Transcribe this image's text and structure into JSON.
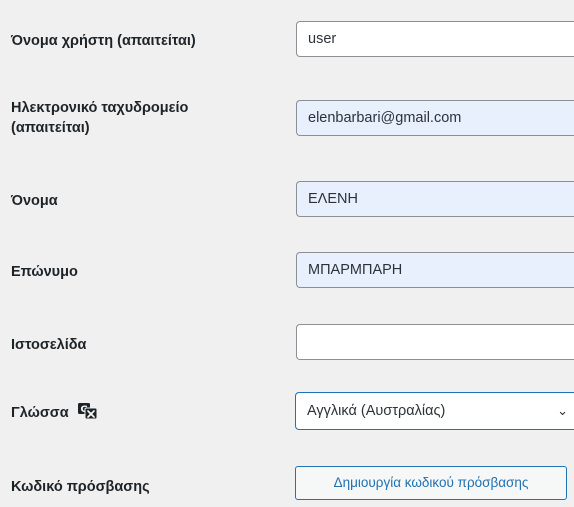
{
  "fields": {
    "username": {
      "label": "Όνομα χρήστη (απαιτείται)",
      "value": "user"
    },
    "email": {
      "label_line1": "Ηλεκτρονικό ταχυδρομείο",
      "label_line2": "(απαιτείται)",
      "value": "elenbarbari@gmail.com"
    },
    "first_name": {
      "label": "Όνομα",
      "value": "ΕΛΕΝΗ"
    },
    "last_name": {
      "label": "Επώνυμο",
      "value": "ΜΠΑΡΜΠΑΡΗ"
    },
    "website": {
      "label": "Ιστοσελίδα",
      "value": ""
    },
    "language": {
      "label": "Γλώσσα",
      "selected": "Αγγλικά (Αυστραλίας)",
      "icon": "translation-icon",
      "chevron": "⌄"
    },
    "password": {
      "label": "Κωδικό πρόσβασης",
      "button_label": "Δημιουργία κωδικού πρόσβασης"
    }
  },
  "colors": {
    "background": "#f0f0f1",
    "autofill": "#e8f0fe",
    "accent": "#2271b1",
    "text": "#1d2327"
  }
}
